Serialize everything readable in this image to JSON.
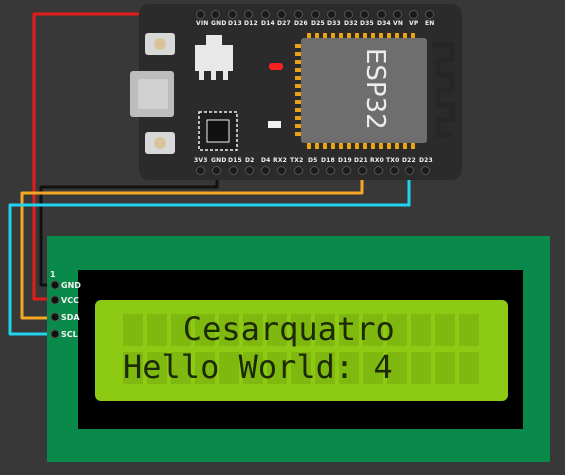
{
  "esp32": {
    "chip_label": "ESP32",
    "top_pins": [
      "VIN",
      "GND",
      "D13",
      "D12",
      "D14",
      "D27",
      "D26",
      "D25",
      "D33",
      "D32",
      "D35",
      "D34",
      "VN",
      "VP",
      "EN"
    ],
    "bottom_pins": [
      "3V3",
      "GND",
      "D15",
      "D2",
      "D4",
      "RX2",
      "TX2",
      "D5",
      "D18",
      "D19",
      "D21",
      "RX0",
      "TX0",
      "D22",
      "D23"
    ]
  },
  "lcd": {
    "pin_index": "1",
    "pins": [
      "GND",
      "VCC",
      "SDA",
      "SCL"
    ],
    "line1": "   Cesarquatro",
    "line2": "Hello World: 4"
  },
  "colors": {
    "wire_vin": "#e21b1b",
    "wire_gnd": "#111111",
    "wire_sda": "#f5a623",
    "wire_scl": "#22d3ee",
    "lcd_backlight": "#8dca14",
    "pcb_green": "#0a8a4a",
    "led_red": "#ff2020"
  }
}
